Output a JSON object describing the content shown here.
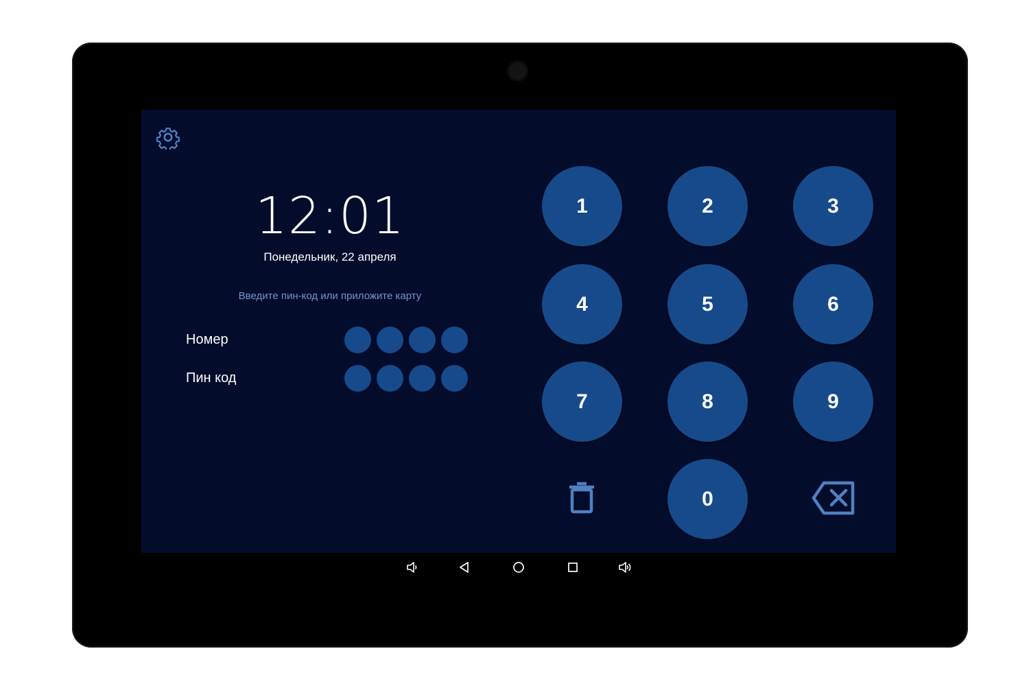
{
  "clock": {
    "time": "12:01",
    "date": "Понедельник, 22 апреля"
  },
  "hint": "Введите пин-код или приложите карту",
  "fields": {
    "number": {
      "label": "Номер",
      "dots": 4
    },
    "pin": {
      "label": "Пин код",
      "dots": 4
    }
  },
  "keypad": {
    "keys": [
      "1",
      "2",
      "3",
      "4",
      "5",
      "6",
      "7",
      "8",
      "9",
      "0"
    ],
    "clear_icon": "trash-icon",
    "backspace_icon": "backspace-icon"
  },
  "settings_icon": "gear-icon",
  "navbar": {
    "icons": [
      "volume-down-icon",
      "back-icon",
      "home-icon",
      "recents-icon",
      "volume-up-icon"
    ]
  },
  "colors": {
    "screen_bg": "#030c2b",
    "key_bg": "#164a8a",
    "hint_text": "#6e95cf",
    "icon_color": "#4f80c2"
  }
}
